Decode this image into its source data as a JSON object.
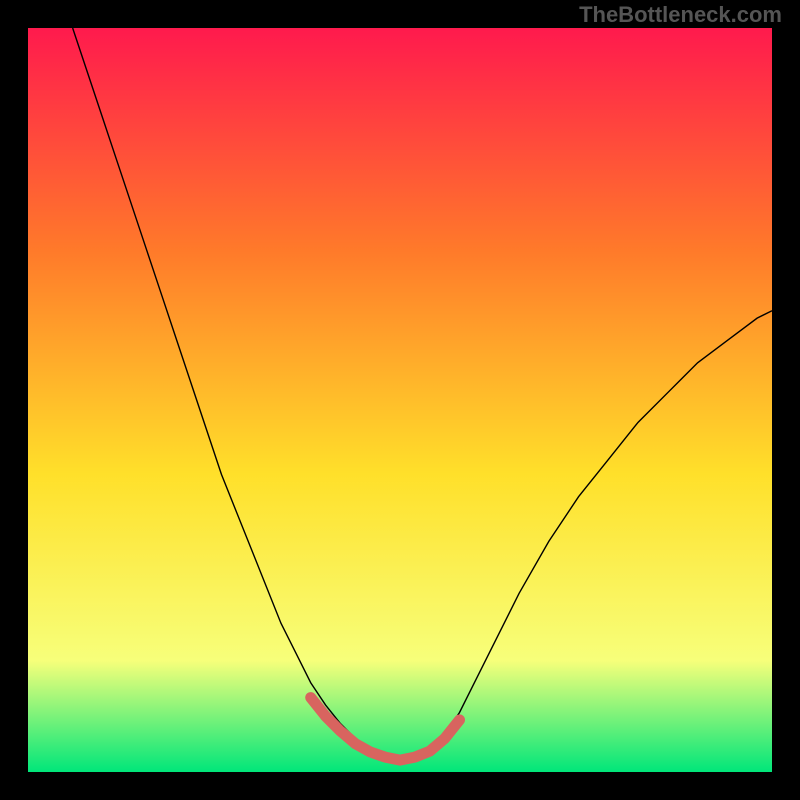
{
  "watermark": "TheBottleneck.com",
  "chart_data": {
    "type": "line",
    "title": "",
    "xlabel": "",
    "ylabel": "",
    "xlim": [
      0,
      100
    ],
    "ylim": [
      0,
      100
    ],
    "grid": false,
    "legend": false,
    "background_gradient": {
      "top": "#ff1a4d",
      "upper_mid": "#ff7a2a",
      "mid": "#ffe02a",
      "lower_mid": "#f7ff7a",
      "bottom": "#00e67a"
    },
    "series": [
      {
        "name": "valley-curve",
        "color": "#000000",
        "stroke_width": 1.4,
        "x": [
          6,
          8,
          10,
          12,
          14,
          16,
          18,
          20,
          22,
          24,
          26,
          28,
          30,
          32,
          34,
          36,
          38,
          40,
          42,
          44,
          46,
          48,
          50,
          52,
          54,
          56,
          58,
          60,
          62,
          66,
          70,
          74,
          78,
          82,
          86,
          90,
          94,
          98,
          100
        ],
        "values": [
          100,
          94,
          88,
          82,
          76,
          70,
          64,
          58,
          52,
          46,
          40,
          35,
          30,
          25,
          20,
          16,
          12,
          9,
          6.5,
          4.5,
          3,
          2,
          1.5,
          2,
          3,
          5,
          8,
          12,
          16,
          24,
          31,
          37,
          42,
          47,
          51,
          55,
          58,
          61,
          62
        ]
      },
      {
        "name": "highlight-bottom",
        "color": "#d8645f",
        "stroke_width": 11,
        "stroke_linecap": "round",
        "x": [
          38,
          40,
          42,
          44,
          46,
          48,
          50,
          52,
          54,
          56,
          58
        ],
        "values": [
          10,
          7.5,
          5.5,
          3.8,
          2.7,
          2.0,
          1.6,
          2.0,
          2.8,
          4.5,
          7.0
        ]
      }
    ]
  }
}
